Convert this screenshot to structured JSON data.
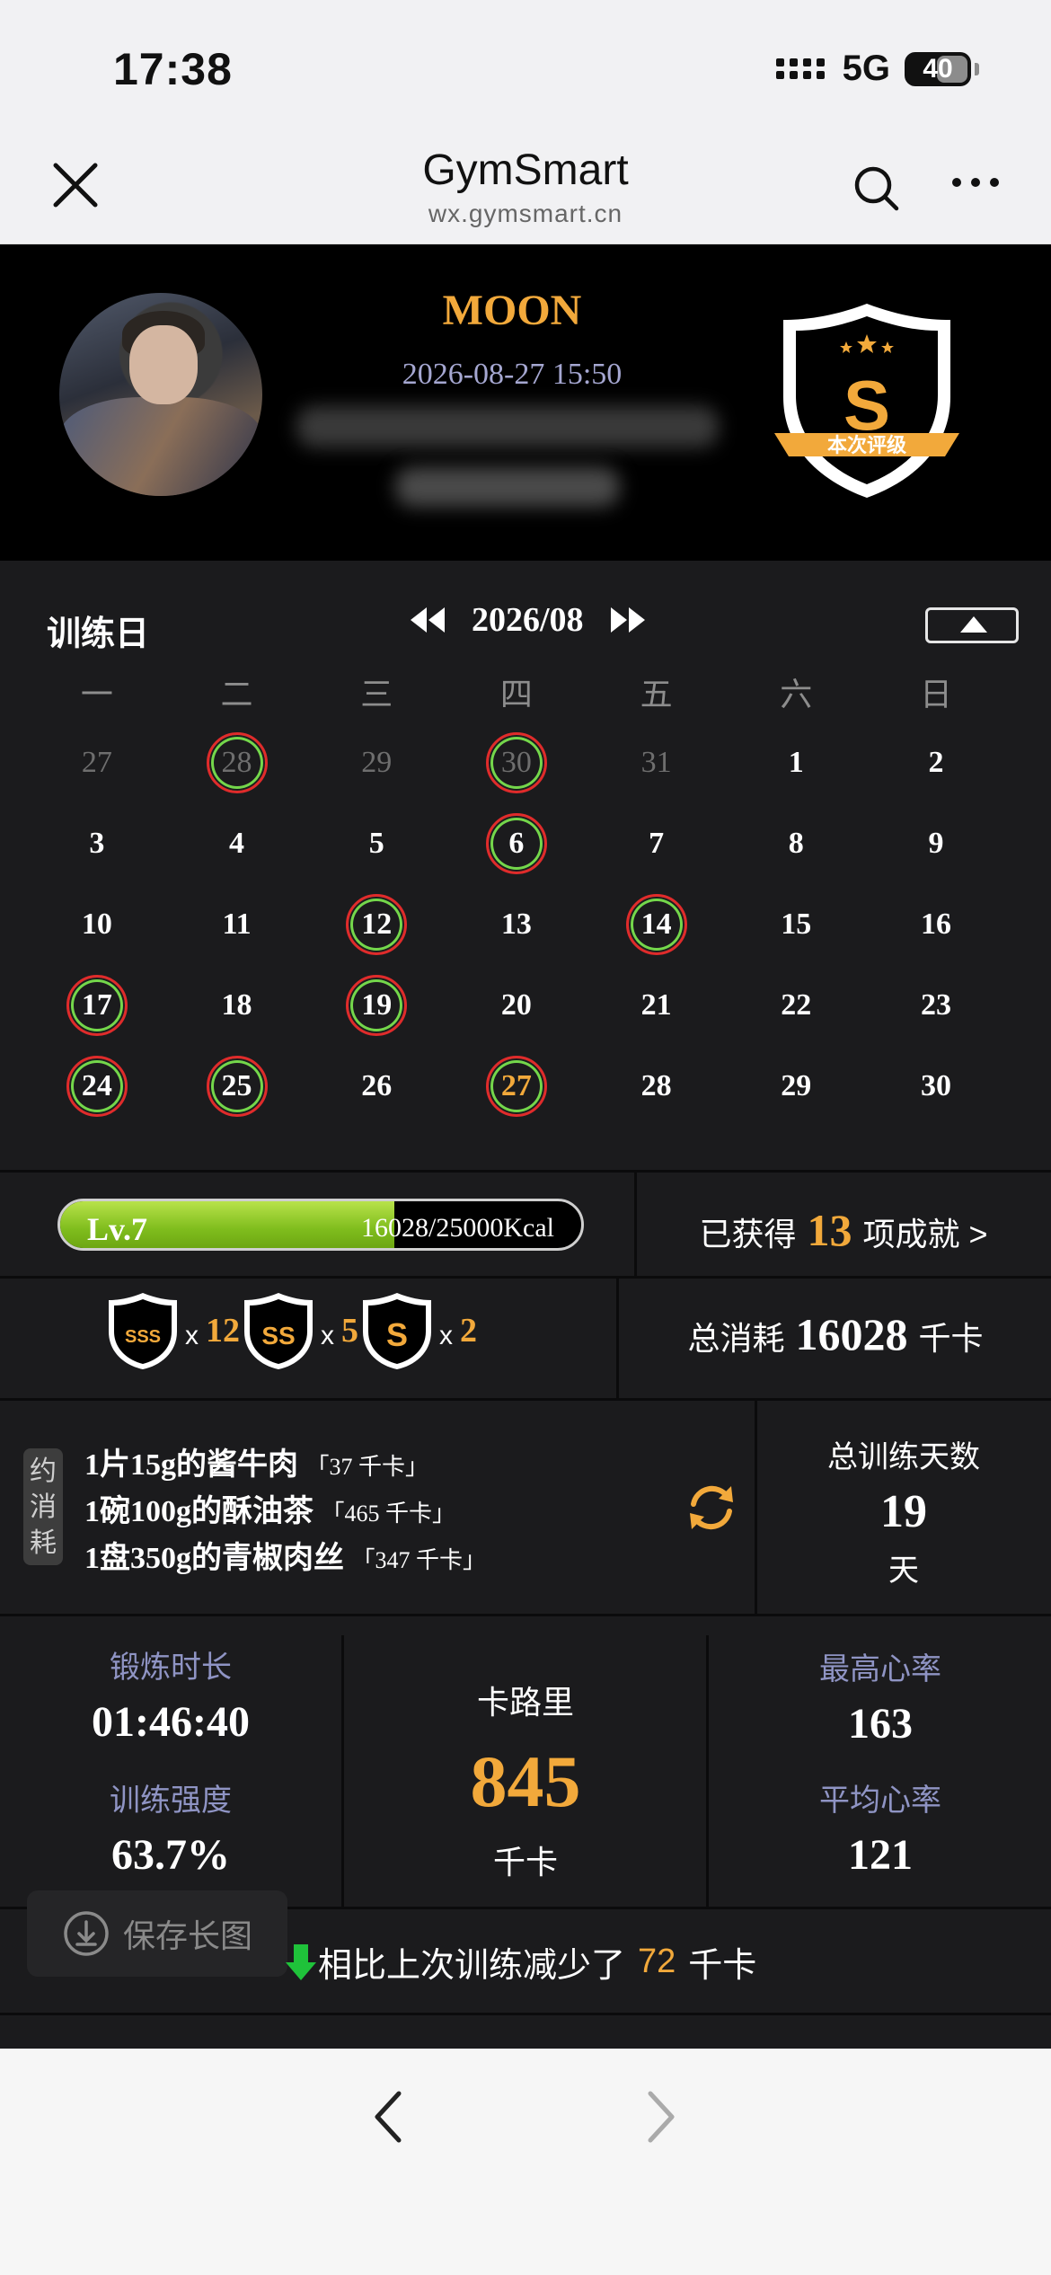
{
  "status": {
    "time": "17:38",
    "network": "5G",
    "battery": "40"
  },
  "nav": {
    "title": "GymSmart",
    "subtitle": "wx.gymsmart.cn"
  },
  "profile": {
    "name": "MOON",
    "datetime": "2026-08-27 15:50",
    "badge_grade": "S",
    "badge_label": "本次评级"
  },
  "calendar": {
    "title": "训练日",
    "month": "2026/08",
    "weekdays": [
      "一",
      "二",
      "三",
      "四",
      "五",
      "六",
      "日"
    ],
    "days": [
      {
        "d": "27",
        "other": true,
        "trained": false
      },
      {
        "d": "28",
        "other": true,
        "trained": true
      },
      {
        "d": "29",
        "other": true,
        "trained": false
      },
      {
        "d": "30",
        "other": true,
        "trained": true
      },
      {
        "d": "31",
        "other": true,
        "trained": false
      },
      {
        "d": "1",
        "other": false,
        "trained": false
      },
      {
        "d": "2",
        "other": false,
        "trained": false
      },
      {
        "d": "3",
        "other": false,
        "trained": false
      },
      {
        "d": "4",
        "other": false,
        "trained": false
      },
      {
        "d": "5",
        "other": false,
        "trained": false
      },
      {
        "d": "6",
        "other": false,
        "trained": true
      },
      {
        "d": "7",
        "other": false,
        "trained": false
      },
      {
        "d": "8",
        "other": false,
        "trained": false
      },
      {
        "d": "9",
        "other": false,
        "trained": false
      },
      {
        "d": "10",
        "other": false,
        "trained": false
      },
      {
        "d": "11",
        "other": false,
        "trained": false
      },
      {
        "d": "12",
        "other": false,
        "trained": true
      },
      {
        "d": "13",
        "other": false,
        "trained": false
      },
      {
        "d": "14",
        "other": false,
        "trained": true
      },
      {
        "d": "15",
        "other": false,
        "trained": false
      },
      {
        "d": "16",
        "other": false,
        "trained": false
      },
      {
        "d": "17",
        "other": false,
        "trained": true
      },
      {
        "d": "18",
        "other": false,
        "trained": false
      },
      {
        "d": "19",
        "other": false,
        "trained": true
      },
      {
        "d": "20",
        "other": false,
        "trained": false
      },
      {
        "d": "21",
        "other": false,
        "trained": false
      },
      {
        "d": "22",
        "other": false,
        "trained": false
      },
      {
        "d": "23",
        "other": false,
        "trained": false
      },
      {
        "d": "24",
        "other": false,
        "trained": true
      },
      {
        "d": "25",
        "other": false,
        "trained": true
      },
      {
        "d": "26",
        "other": false,
        "trained": false
      },
      {
        "d": "27",
        "other": false,
        "trained": true,
        "today": true
      },
      {
        "d": "28",
        "other": false,
        "trained": false
      },
      {
        "d": "29",
        "other": false,
        "trained": false
      },
      {
        "d": "30",
        "other": false,
        "trained": false
      }
    ]
  },
  "level": {
    "label": "Lv.7",
    "kcal_text": "16028/25000Kcal",
    "progress": 0.641
  },
  "achievements": {
    "prefix": "已获得",
    "count": "13",
    "suffix": "项成就 >"
  },
  "grades": [
    {
      "grade": "SSS",
      "times": "x",
      "count": "12"
    },
    {
      "grade": "SS",
      "times": "x",
      "count": "5"
    },
    {
      "grade": "S",
      "times": "x",
      "count": "2"
    }
  ],
  "total": {
    "label": "总消耗",
    "value": "16028",
    "unit": "千卡"
  },
  "equivalent": {
    "tag_chars": [
      "约",
      "消",
      "耗"
    ],
    "items": [
      {
        "text": "1片15g的酱牛肉",
        "kcal": "「37 千卡」"
      },
      {
        "text": "1碗100g的酥油茶",
        "kcal": "「465 千卡」"
      },
      {
        "text": "1盘350g的青椒肉丝",
        "kcal": "「347 千卡」"
      }
    ]
  },
  "training_days": {
    "label": "总训练天数",
    "value": "19",
    "unit": "天"
  },
  "stats": {
    "duration_label": "锻炼时长",
    "duration": "01:46:40",
    "intensity_label": "训练强度",
    "intensity": "63.7%",
    "calorie_label": "卡路里",
    "calorie": "845",
    "calorie_unit": "千卡",
    "max_hr_label": "最高心率",
    "max_hr": "163",
    "avg_hr_label": "平均心率",
    "avg_hr": "121"
  },
  "compare": {
    "text": "相比上次训练减少了",
    "value": "72",
    "unit": "千卡"
  },
  "save_label": "保存长图",
  "colors": {
    "accent": "#f2a93b",
    "trained_ring_outer": "#e02b2b",
    "trained_ring_inner": "#74d74b",
    "level_bar": "#8dc726"
  }
}
